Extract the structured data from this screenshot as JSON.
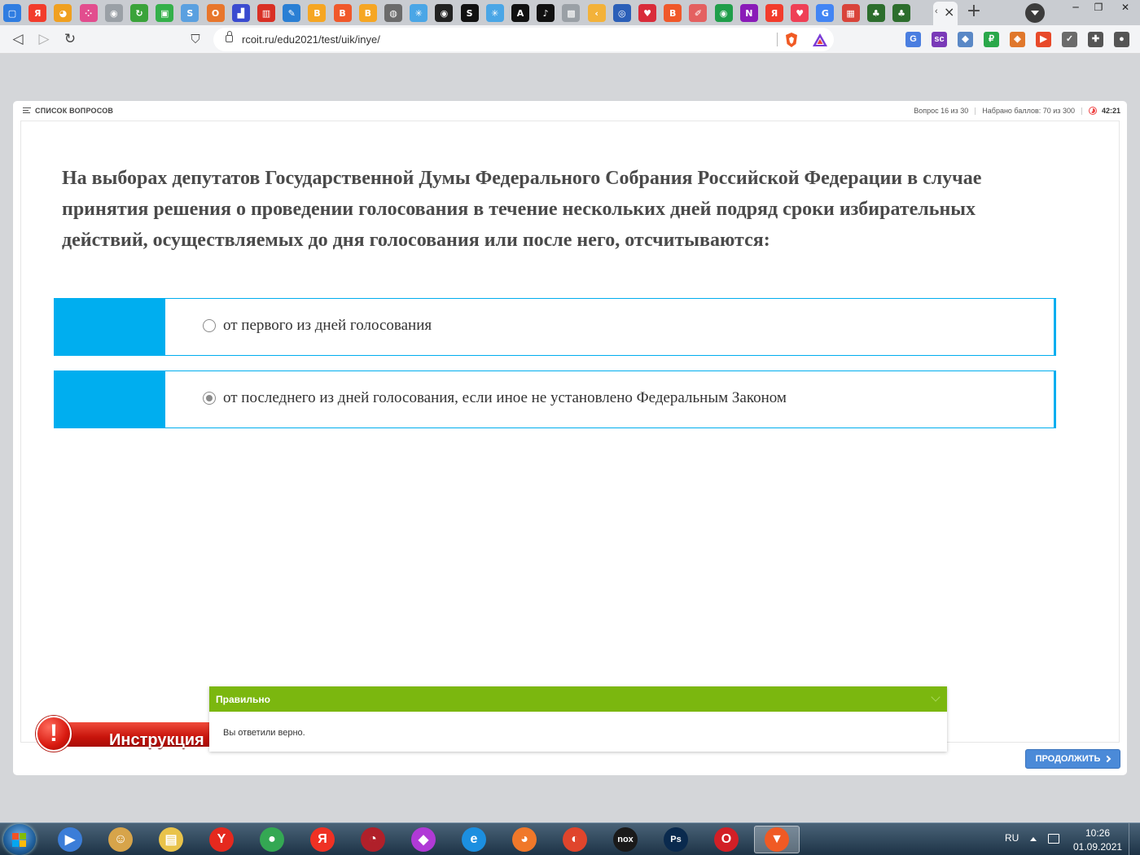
{
  "browser": {
    "url": "rcoit.ru/edu2021/test/uik/inye/",
    "tab_favicons": [
      {
        "name": "messenger-tab-icon",
        "glyph": "▢",
        "color": "#2f7de1"
      },
      {
        "name": "yandex-tab-icon",
        "glyph": "Я",
        "color": "#f23c2c"
      },
      {
        "name": "pie-tab-icon",
        "glyph": "◕",
        "color": "#f0a020"
      },
      {
        "name": "dots-tab-icon",
        "glyph": "⁘",
        "color": "#e24d8e"
      },
      {
        "name": "eye-tab-icon",
        "glyph": "◉",
        "color": "#9aa0a6"
      },
      {
        "name": "refresh-tab-icon",
        "glyph": "↻",
        "color": "#3aa33a"
      },
      {
        "name": "green-tab-icon",
        "glyph": "▣",
        "color": "#34b04a"
      },
      {
        "name": "serf-tab-icon",
        "glyph": "S",
        "color": "#5aa0e0"
      },
      {
        "name": "onlysurf-tab-icon",
        "glyph": "O",
        "color": "#e8762c"
      },
      {
        "name": "chart-tab-icon",
        "glyph": "▟",
        "color": "#3a4bd0"
      },
      {
        "name": "bars-tab-icon",
        "glyph": "▥",
        "color": "#d93025"
      },
      {
        "name": "pin-tab-icon",
        "glyph": "✎",
        "color": "#2a7fd4"
      },
      {
        "name": "blogger-tab-icon",
        "glyph": "B",
        "color": "#f6a623"
      },
      {
        "name": "b-red-tab-icon",
        "glyph": "B",
        "color": "#f0582a"
      },
      {
        "name": "blogger2-tab-icon",
        "glyph": "B",
        "color": "#f6a623"
      },
      {
        "name": "globe-tab-icon",
        "glyph": "◍",
        "color": "#6b6b6b"
      },
      {
        "name": "snow-tab-icon",
        "glyph": "✳",
        "color": "#4aa6e6"
      },
      {
        "name": "eye-dark-tab-icon",
        "glyph": "◉",
        "color": "#222222"
      },
      {
        "name": "seo-tab-icon",
        "glyph": "S",
        "color": "#111111"
      },
      {
        "name": "snow2-tab-icon",
        "glyph": "✳",
        "color": "#4aa6e6"
      },
      {
        "name": "a-tab-icon",
        "glyph": "A",
        "color": "#111111"
      },
      {
        "name": "tiktok-tab-icon",
        "glyph": "♪",
        "color": "#111111"
      },
      {
        "name": "box-tab-icon",
        "glyph": "▩",
        "color": "#9aa0a6"
      },
      {
        "name": "arrow-tab-icon",
        "glyph": "‹",
        "color": "#f3b23a"
      },
      {
        "name": "target-tab-icon",
        "glyph": "◎",
        "color": "#2b5fb8"
      },
      {
        "name": "heart-tab-icon",
        "glyph": "♥",
        "color": "#d92c3a"
      },
      {
        "name": "blogger3-tab-icon",
        "glyph": "B",
        "color": "#f0582a"
      },
      {
        "name": "feather-tab-icon",
        "glyph": "✐",
        "color": "#e46060"
      },
      {
        "name": "circle-tab-icon",
        "glyph": "◉",
        "color": "#1f9e4a"
      },
      {
        "name": "n-tab-icon",
        "glyph": "N",
        "color": "#8a1bb8"
      },
      {
        "name": "yandex2-tab-icon",
        "glyph": "Я",
        "color": "#f23c2c"
      },
      {
        "name": "pocket-tab-icon",
        "glyph": "♥",
        "color": "#ef4056"
      },
      {
        "name": "google-tab-icon",
        "glyph": "G",
        "color": "#4285f4"
      },
      {
        "name": "grid-tab-icon",
        "glyph": "▦",
        "color": "#d9443a"
      },
      {
        "name": "people-tab-icon",
        "glyph": "♣",
        "color": "#2d6e2d"
      },
      {
        "name": "people2-tab-icon",
        "glyph": "♣",
        "color": "#2d6e2d"
      }
    ],
    "extension_icons": [
      {
        "name": "translate-ext-icon",
        "glyph": "G",
        "color": "#4a7ee0"
      },
      {
        "name": "sc-ext-icon",
        "glyph": "sc",
        "color": "#7a3ab8"
      },
      {
        "name": "lock-ext-icon",
        "glyph": "◆",
        "color": "#5a88c6"
      },
      {
        "name": "ruble-ext-icon",
        "glyph": "₽",
        "color": "#2aa84a"
      },
      {
        "name": "cube-ext-icon",
        "glyph": "◈",
        "color": "#e0782c"
      },
      {
        "name": "play-ext-icon",
        "glyph": "▶",
        "color": "#e84a2a"
      },
      {
        "name": "shield-ext-icon",
        "glyph": "✓",
        "color": "#6b6b6b"
      },
      {
        "name": "puzzle-ext-icon",
        "glyph": "✚",
        "color": "#555555"
      },
      {
        "name": "user-ext-icon",
        "glyph": "●",
        "color": "#555555"
      }
    ]
  },
  "quiz": {
    "question_list_label": "СПИСОК ВОПРОСОВ",
    "question_counter": "Вопрос 16 из 30",
    "score": "Набрано баллов: 70 из 300",
    "timer": "42:21",
    "question": "На выборах депутатов Государственной Думы Федерального Собрания Российской Федерации в случае принятия решения о проведении голосования в течение нескольких дней подряд сроки избирательных действий, осуществляемых до дня голосования или после него, отсчитываются:",
    "answers": [
      {
        "text": "от первого из дней голосования",
        "checked": false
      },
      {
        "text": "от последнего из дней голосования, если иное не установлено Федеральным Законом",
        "checked": true
      }
    ],
    "feedback": {
      "title": "Правильно",
      "message": "Вы ответили верно."
    },
    "instruction_label": "Инструкция",
    "continue_label": "ПРОДОЛЖИТЬ",
    "accent_color": "#00aeef",
    "correct_color": "#7bb70f"
  },
  "taskbar": {
    "apps": [
      {
        "name": "media-player-app",
        "glyph": "▶",
        "color": "#3b7dd8"
      },
      {
        "name": "contacts-app",
        "glyph": "☺",
        "color": "#d7a44a"
      },
      {
        "name": "explorer-app",
        "glyph": "▤",
        "color": "#e9c34a"
      },
      {
        "name": "yandex-browser-app",
        "glyph": "Y",
        "color": "#e5291e"
      },
      {
        "name": "chrome-app",
        "glyph": "●",
        "color": "#34a853"
      },
      {
        "name": "yandex-app",
        "glyph": "Я",
        "color": "#ef3124"
      },
      {
        "name": "comodo-app",
        "glyph": "◔",
        "color": "#b0202a"
      },
      {
        "name": "polypane-app",
        "glyph": "◆",
        "color": "#b03ad6"
      },
      {
        "name": "ie-app",
        "glyph": "e",
        "color": "#1c8fe0"
      },
      {
        "name": "firefox-app",
        "glyph": "◕",
        "color": "#f0782a"
      },
      {
        "name": "cent-app",
        "glyph": "◐",
        "color": "#e0452c"
      },
      {
        "name": "nox-app",
        "glyph": "nox",
        "color": "#1a1a1a"
      },
      {
        "name": "photoshop-app",
        "glyph": "Ps",
        "color": "#0a2a4e"
      },
      {
        "name": "opera-app",
        "glyph": "O",
        "color": "#d21f26"
      },
      {
        "name": "brave-app",
        "glyph": "▼",
        "color": "#f05a24"
      }
    ],
    "language": "RU",
    "time": "10:26",
    "date": "01.09.2021"
  }
}
